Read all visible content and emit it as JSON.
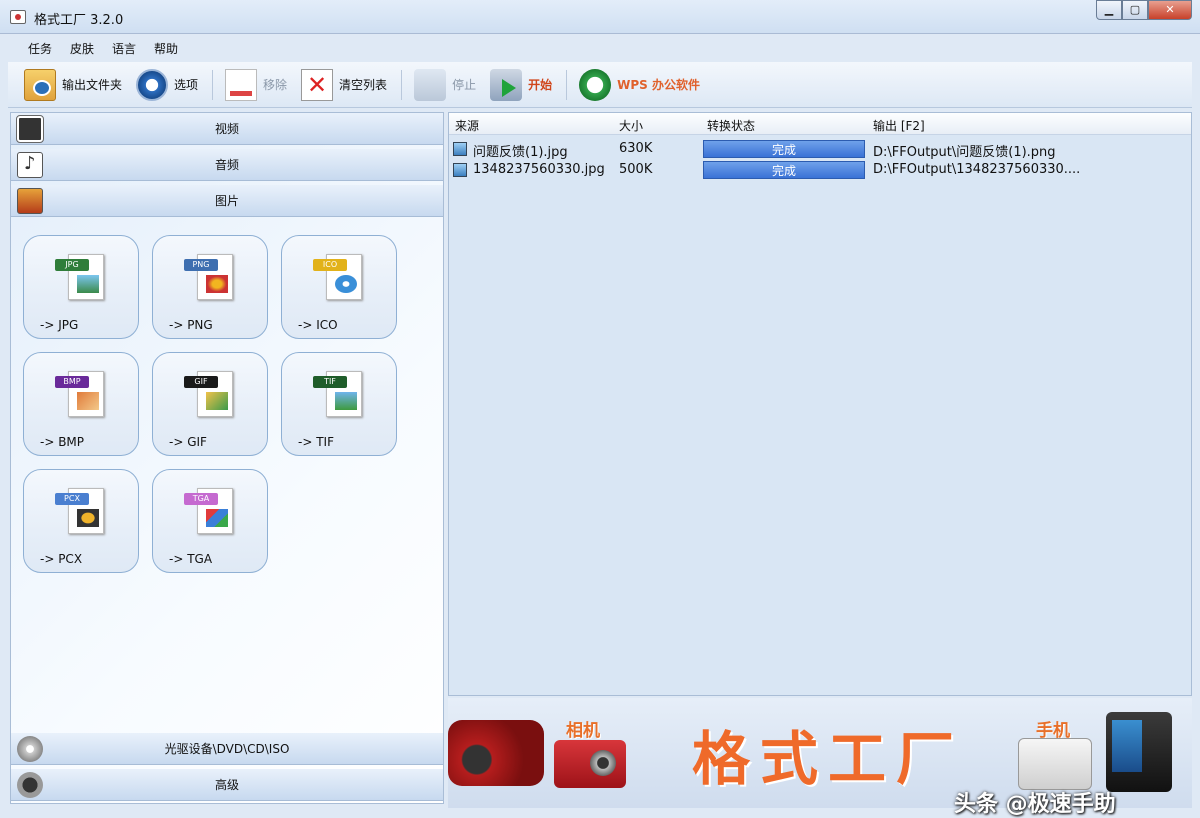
{
  "window": {
    "title": "格式工厂 3.2.0",
    "minimize": "▁",
    "maximize": "▢",
    "close": "✕"
  },
  "menu": [
    "任务",
    "皮肤",
    "语言",
    "帮助"
  ],
  "toolbar": {
    "output_folder": "输出文件夹",
    "options": "选项",
    "remove": "移除",
    "clear_list": "清空列表",
    "stop": "停止",
    "start": "开始",
    "wps": "WPS 办公软件"
  },
  "categories": {
    "video": "视频",
    "audio": "音频",
    "image": "图片",
    "disc": "光驱设备\\DVD\\CD\\ISO",
    "advanced": "高级"
  },
  "image_tiles": [
    {
      "tag": "JPG",
      "label": "-> JPG",
      "tag_color": "#2f7d3a"
    },
    {
      "tag": "PNG",
      "label": "-> PNG",
      "tag_color": "#3e6fb0"
    },
    {
      "tag": "ICO",
      "label": "-> ICO",
      "tag_color": "#e2b21a"
    },
    {
      "tag": "BMP",
      "label": "-> BMP",
      "tag_color": "#6a2a9a"
    },
    {
      "tag": "GIF",
      "label": "-> GIF",
      "tag_color": "#1a1a1a"
    },
    {
      "tag": "TIF",
      "label": "-> TIF",
      "tag_color": "#1f5d2a"
    },
    {
      "tag": "PCX",
      "label": "-> PCX",
      "tag_color": "#4a7fd0"
    },
    {
      "tag": "TGA",
      "label": "-> TGA",
      "tag_color": "#c56ad0"
    }
  ],
  "file_list": {
    "columns": [
      "来源",
      "大小",
      "转换状态",
      "输出 [F2]"
    ],
    "rows": [
      {
        "source": "问题反馈(1).jpg",
        "size": "630K",
        "status": "完成",
        "output": "D:\\FFOutput\\问题反馈(1).png"
      },
      {
        "source": "1348237560330.jpg",
        "size": "500K",
        "status": "完成",
        "output": "D:\\FFOutput\\1348237560330...."
      }
    ]
  },
  "banner": {
    "title": "格式工厂",
    "camera_label": "相机",
    "phone_label": "手机"
  },
  "watermark": "头条 @极速手助"
}
